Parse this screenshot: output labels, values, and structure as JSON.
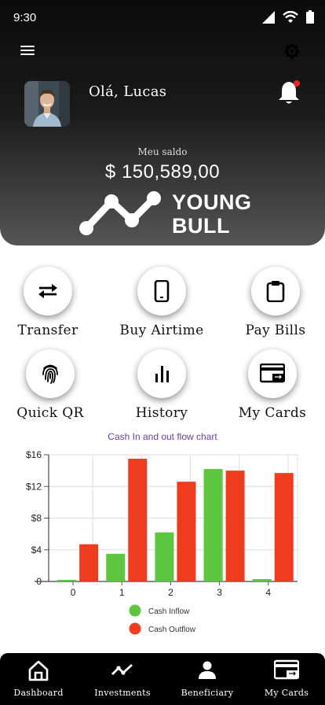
{
  "status_bar": {
    "time": "9:30"
  },
  "header": {
    "greeting": "Olá, Lucas",
    "balance_label": "Meu saldo",
    "balance_value": "$ 150,589,00",
    "logo_line1": "YOUNG",
    "logo_line2": "BULL"
  },
  "actions": [
    {
      "label": "Transfer",
      "icon": "swap-arrows-icon"
    },
    {
      "label": "Buy Airtime",
      "icon": "phone-icon"
    },
    {
      "label": "Pay Bills",
      "icon": "clipboard-icon"
    },
    {
      "label": "Quick QR",
      "icon": "fingerprint-icon"
    },
    {
      "label": "History",
      "icon": "bar-chart-icon"
    },
    {
      "label": "My Cards",
      "icon": "card-icon"
    }
  ],
  "chart_data": {
    "type": "bar",
    "title": "Cash In and out flow chart",
    "categories": [
      "0",
      "1",
      "2",
      "3",
      "4"
    ],
    "series": [
      {
        "name": "Cash Inflow",
        "color": "#5cc63f",
        "values": [
          0.2,
          3.5,
          6.2,
          14.2,
          0.3
        ]
      },
      {
        "name": "Cash Outflow",
        "color": "#f03c1e",
        "values": [
          4.7,
          15.5,
          12.6,
          14.0,
          13.7
        ]
      }
    ],
    "ylim": [
      0,
      16
    ],
    "yticks": [
      "0",
      "$4",
      "$8",
      "$12",
      "$16"
    ],
    "grid": true,
    "legend_position": "bottom"
  },
  "bottom_nav": [
    {
      "label": "Dashboard",
      "icon": "home-icon"
    },
    {
      "label": "Investments",
      "icon": "trend-line-icon"
    },
    {
      "label": "Beneficiary",
      "icon": "person-icon"
    },
    {
      "label": "My Cards",
      "icon": "card-icon"
    }
  ]
}
